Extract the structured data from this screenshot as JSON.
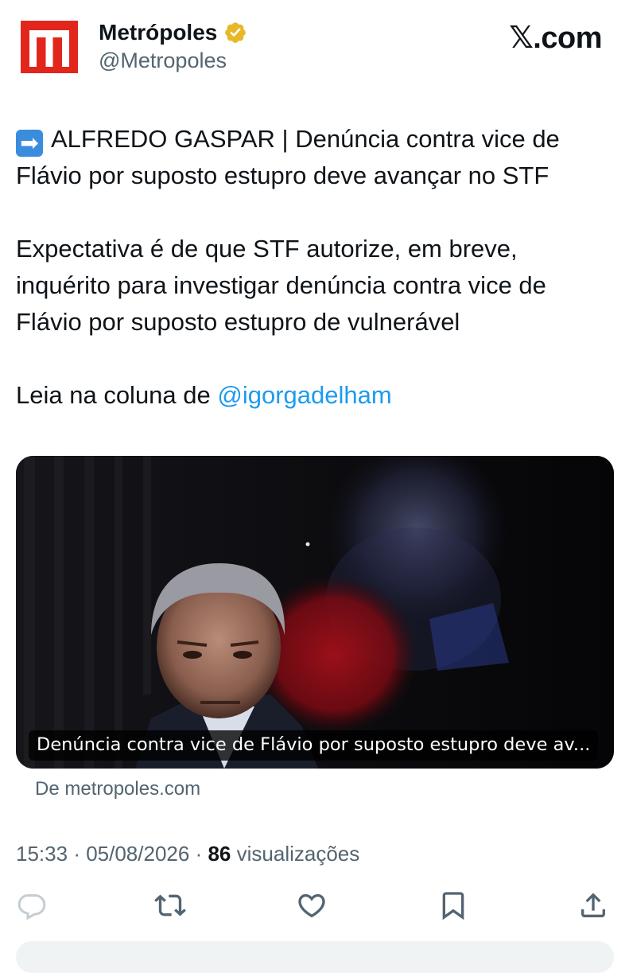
{
  "account": {
    "display_name": "Metrópoles",
    "handle": "@Metropoles",
    "verified_icon": "verified-gold-badge-icon",
    "brand_color": "#e2261c"
  },
  "site_label": "𝕏.com",
  "tweet": {
    "line1_emoji": "right-arrow-emoji",
    "line1_text": "ALFREDO GASPAR | Denúncia contra vice de Flávio por suposto estupro deve avançar no STF",
    "paragraph2": "Expectativa é de que STF autorize, em breve, inquérito para investigar denúncia contra vice de Flávio por suposto estupro de vulnerável",
    "paragraph3_prefix": "Leia na coluna de ",
    "mention": "@igorgadelham",
    "mention_color": "#1d9bf0"
  },
  "link_card": {
    "caption": "Denúncia contra vice de Flávio por suposto estupro deve av...",
    "source": "De metropoles.com"
  },
  "meta": {
    "time": "15:33",
    "date": "05/08/2026",
    "views_count": "86",
    "views_label": "visualizações"
  },
  "actions": {
    "reply_icon": "reply-icon",
    "retweet_icon": "retweet-icon",
    "like_icon": "heart-icon",
    "bookmark_icon": "bookmark-icon",
    "share_icon": "share-icon"
  }
}
